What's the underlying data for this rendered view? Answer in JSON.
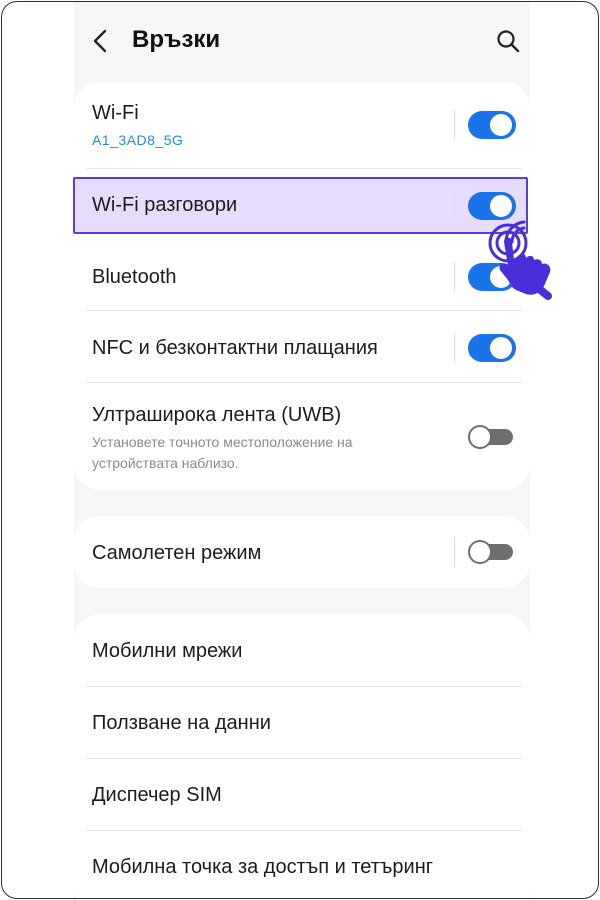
{
  "header": {
    "title": "Връзки",
    "back_icon": "back-chevron-icon",
    "search_icon": "search-icon"
  },
  "connections": [
    {
      "id": "wifi",
      "label": "Wi-Fi",
      "sub": "A1_3AD8_5G",
      "toggle": true
    },
    {
      "id": "wifi-calling",
      "label": "Wi-Fi разговори",
      "toggle": true,
      "highlighted": true
    },
    {
      "id": "bluetooth",
      "label": "Bluetooth",
      "toggle": true
    },
    {
      "id": "nfc",
      "label": "NFC и безконтактни плащания",
      "toggle": true
    },
    {
      "id": "uwb",
      "label": "Ултраширока лента (UWB)",
      "desc": "Установете точното местоположение на устройствата наблизо.",
      "toggle": false
    }
  ],
  "airplane": {
    "label": "Самолетен режим",
    "toggle": false
  },
  "more": [
    {
      "label": "Мобилни мрежи"
    },
    {
      "label": "Ползване на данни"
    },
    {
      "label": "Диспечер SIM"
    },
    {
      "label": "Мобилна точка за достъп и тетъринг"
    }
  ],
  "colors": {
    "accent": "#1a73e8",
    "highlight_fill": "#e7dcfb",
    "highlight_border": "#5a3ed6",
    "tap_hand": "#4a2ed8",
    "subtitle": "#1a8fd6"
  },
  "tap_indicator_icon": "tap-hand-icon"
}
